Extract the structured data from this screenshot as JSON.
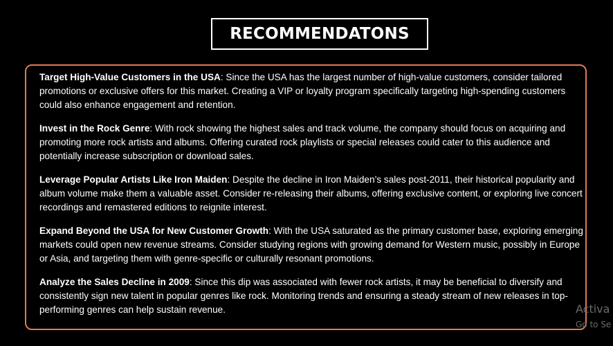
{
  "title": "RECOMMENDATONS",
  "recommendations": [
    {
      "heading": "Target High-Value Customers in the USA",
      "body": ": Since the USA has the largest number of high-value customers, consider tailored promotions or exclusive offers for this market. Creating a VIP or loyalty program specifically targeting high-spending customers could also enhance engagement and retention."
    },
    {
      "heading": "Invest in the Rock Genre",
      "body": ": With rock showing the highest sales and track volume, the company should focus on acquiring and promoting more rock artists and albums. Offering curated rock playlists or special releases could cater to this audience and potentially increase subscription or download sales."
    },
    {
      "heading": "Leverage Popular Artists Like Iron Maiden",
      "body": ": Despite the decline in Iron Maiden’s sales post-2011, their historical popularity and album volume make them a valuable asset. Consider re-releasing their albums, offering exclusive content, or exploring live concert recordings and remastered editions to reignite interest."
    },
    {
      "heading": "Expand Beyond the USA for New Customer Growth",
      "body": ": With the USA saturated as the primary customer base, exploring emerging markets could open new revenue streams. Consider studying regions with growing demand for Western music, possibly in Europe or Asia, and targeting them with genre-specific or culturally resonant promotions."
    },
    {
      "heading": "Analyze the Sales Decline in 2009",
      "body": ": Since this dip was associated with fewer rock artists, it may be beneficial to diversify and consistently sign new talent in popular genres like rock. Monitoring trends and ensuring a steady stream of new releases in top-performing genres can help sustain revenue."
    }
  ],
  "watermark": {
    "line1": "Activa",
    "line2": "Go to Se"
  },
  "colors": {
    "background": "#000000",
    "text": "#ffffff",
    "content_border": "#e07b52",
    "watermark": "#6b6b6b"
  }
}
